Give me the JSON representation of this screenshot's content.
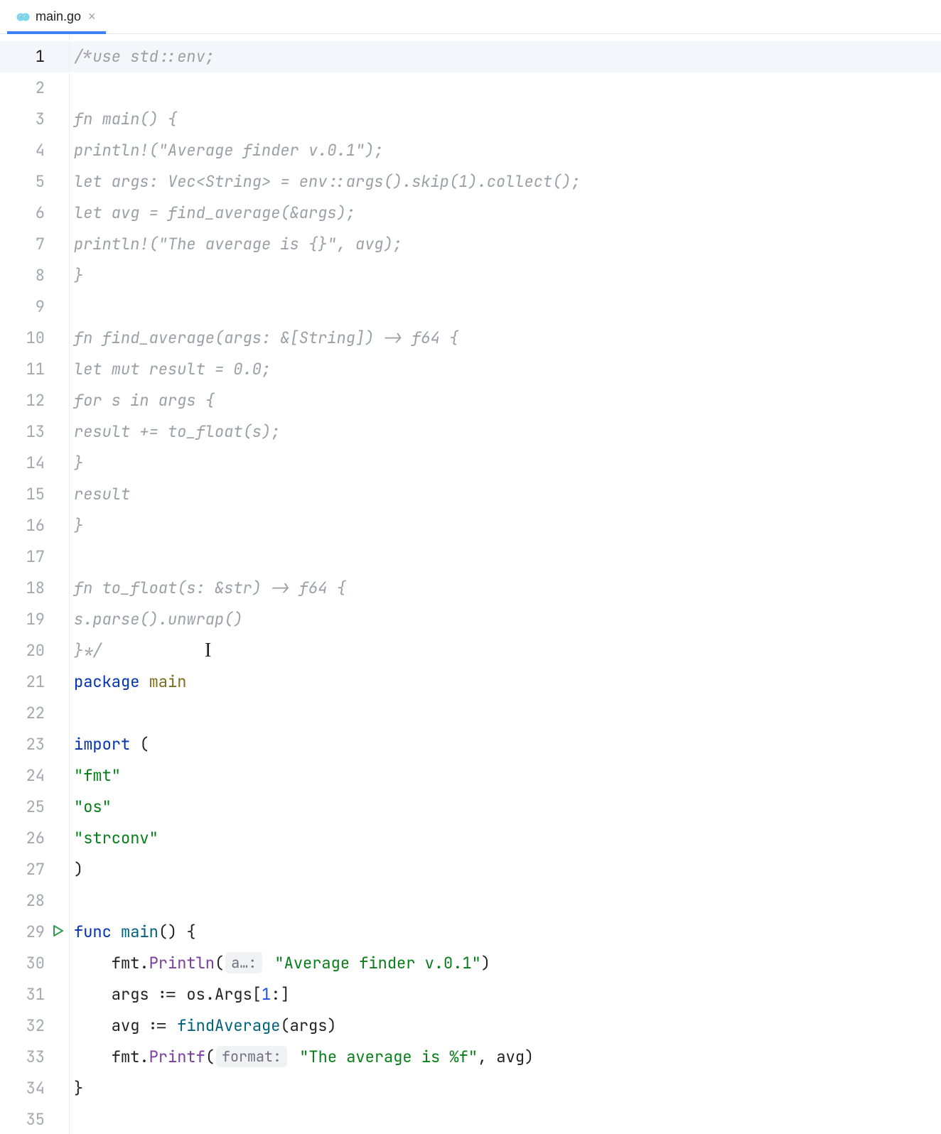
{
  "tab": {
    "filename": "main.go",
    "close_glyph": "×"
  },
  "editor": {
    "current_line": 1,
    "run_gutter_line": 29,
    "lines": [
      {
        "n": 1,
        "segs": [
          {
            "cls": "t-comment",
            "t": "/*use std::env;"
          }
        ]
      },
      {
        "n": 2,
        "segs": []
      },
      {
        "n": 3,
        "segs": [
          {
            "cls": "t-comment",
            "t": "fn main() {"
          }
        ]
      },
      {
        "n": 4,
        "segs": [
          {
            "cls": "t-comment",
            "t": "println!(\"Average finder v.0.1\");"
          }
        ]
      },
      {
        "n": 5,
        "segs": [
          {
            "cls": "t-comment",
            "t": "let args: Vec<String> = env::args().skip(1).collect();"
          }
        ]
      },
      {
        "n": 6,
        "segs": [
          {
            "cls": "t-comment",
            "t": "let avg = find_average(&args);"
          }
        ]
      },
      {
        "n": 7,
        "segs": [
          {
            "cls": "t-comment",
            "t": "println!(\"The average is {}\", avg);"
          }
        ]
      },
      {
        "n": 8,
        "segs": [
          {
            "cls": "t-comment",
            "t": "}"
          }
        ]
      },
      {
        "n": 9,
        "segs": []
      },
      {
        "n": 10,
        "segs": [
          {
            "cls": "t-comment",
            "t": "fn find_average(args: &[String]) -> f64 {"
          }
        ]
      },
      {
        "n": 11,
        "segs": [
          {
            "cls": "t-comment",
            "t": "let mut result = 0.0;"
          }
        ]
      },
      {
        "n": 12,
        "segs": [
          {
            "cls": "t-comment",
            "t": "for s in args {"
          }
        ]
      },
      {
        "n": 13,
        "segs": [
          {
            "cls": "t-comment",
            "t": "result += to_float(s);"
          }
        ]
      },
      {
        "n": 14,
        "segs": [
          {
            "cls": "t-comment",
            "t": "}"
          }
        ]
      },
      {
        "n": 15,
        "segs": [
          {
            "cls": "t-comment",
            "t": "result"
          }
        ]
      },
      {
        "n": 16,
        "segs": [
          {
            "cls": "t-comment",
            "t": "}"
          }
        ]
      },
      {
        "n": 17,
        "segs": []
      },
      {
        "n": 18,
        "segs": [
          {
            "cls": "t-comment",
            "t": "fn to_float(s: &str) -> f64 {"
          }
        ]
      },
      {
        "n": 19,
        "segs": [
          {
            "cls": "t-comment",
            "t": "s.parse().unwrap()"
          }
        ]
      },
      {
        "n": 20,
        "segs": [
          {
            "cls": "t-comment",
            "t": "}*/"
          }
        ]
      },
      {
        "n": 21,
        "segs": [
          {
            "cls": "t-keyword",
            "t": "package "
          },
          {
            "cls": "t-pkgname",
            "t": "main"
          }
        ]
      },
      {
        "n": 22,
        "segs": []
      },
      {
        "n": 23,
        "segs": [
          {
            "cls": "t-keyword",
            "t": "import "
          },
          {
            "cls": "t-punct",
            "t": "("
          }
        ]
      },
      {
        "n": 24,
        "segs": [
          {
            "cls": "t-string",
            "t": "\"fmt\""
          }
        ]
      },
      {
        "n": 25,
        "segs": [
          {
            "cls": "t-string",
            "t": "\"os\""
          }
        ]
      },
      {
        "n": 26,
        "segs": [
          {
            "cls": "t-string",
            "t": "\"strconv\""
          }
        ]
      },
      {
        "n": 27,
        "segs": [
          {
            "cls": "t-punct",
            "t": ")"
          }
        ]
      },
      {
        "n": 28,
        "segs": []
      },
      {
        "n": 29,
        "segs": [
          {
            "cls": "t-keyword",
            "t": "func "
          },
          {
            "cls": "t-funcname",
            "t": "main"
          },
          {
            "cls": "t-punct",
            "t": "() {"
          }
        ]
      },
      {
        "n": 30,
        "segs": [
          {
            "cls": "t-ident",
            "t": "    fmt"
          },
          {
            "cls": "t-punct",
            "t": "."
          },
          {
            "cls": "t-func",
            "t": "Println"
          },
          {
            "cls": "t-punct",
            "t": "("
          },
          {
            "hint": "a…:"
          },
          {
            "cls": "t-string",
            "t": " \"Average finder v.0.1\""
          },
          {
            "cls": "t-punct",
            "t": ")"
          }
        ]
      },
      {
        "n": 31,
        "segs": [
          {
            "cls": "t-ident",
            "t": "    args "
          },
          {
            "cls": "t-punct",
            "t": ":= "
          },
          {
            "cls": "t-ident",
            "t": "os"
          },
          {
            "cls": "t-punct",
            "t": "."
          },
          {
            "cls": "t-ident",
            "t": "Args"
          },
          {
            "cls": "t-punct",
            "t": "["
          },
          {
            "cls": "t-num",
            "t": "1"
          },
          {
            "cls": "t-punct",
            "t": ":]"
          }
        ]
      },
      {
        "n": 32,
        "segs": [
          {
            "cls": "t-ident",
            "t": "    avg "
          },
          {
            "cls": "t-punct",
            "t": ":= "
          },
          {
            "cls": "t-funcname",
            "t": "findAverage"
          },
          {
            "cls": "t-punct",
            "t": "(args)"
          }
        ]
      },
      {
        "n": 33,
        "segs": [
          {
            "cls": "t-ident",
            "t": "    fmt"
          },
          {
            "cls": "t-punct",
            "t": "."
          },
          {
            "cls": "t-func",
            "t": "Printf"
          },
          {
            "cls": "t-punct",
            "t": "("
          },
          {
            "hint": "format:"
          },
          {
            "cls": "t-string",
            "t": " \"The average is %f\""
          },
          {
            "cls": "t-punct",
            "t": ", avg)"
          }
        ]
      },
      {
        "n": 34,
        "segs": [
          {
            "cls": "t-punct",
            "t": "}"
          }
        ]
      },
      {
        "n": 35,
        "segs": []
      }
    ]
  },
  "icons": {
    "go_file": "go-file-icon",
    "run": "run-icon"
  }
}
